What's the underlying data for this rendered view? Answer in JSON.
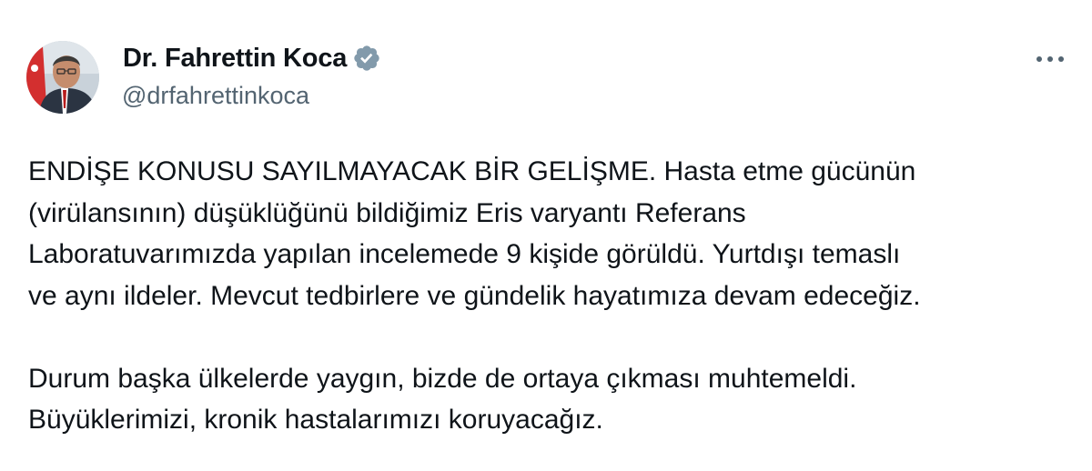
{
  "author": {
    "display_name": "Dr. Fahrettin Koca",
    "handle": "@drfahrettinkoca",
    "verified_icon": "verified-badge-icon",
    "avatar_icon": "profile-avatar",
    "more_icon": "more-options-icon"
  },
  "tweet": {
    "paragraphs": [
      {
        "lines": [
          "ENDİŞE KONUSU SAYILMAYACAK BİR GELİŞME. Hasta etme gücünün",
          "(virülansının) düşüklüğünü bildiğimiz Eris varyantı Referans",
          "Laboratuvarımızda yapılan incelemede 9 kişide görüldü. Yurtdışı temaslı",
          "ve aynı ildeler. Mevcut tedbirlere ve gündelik hayatımıza devam edeceğiz."
        ]
      },
      {
        "lines": [
          "Durum başka ülkelerde yaygın, bizde de ortaya çıkması muhtemeldi.",
          "Büyüklerimizi, kronik hastalarımızı koruyacağız."
        ]
      }
    ]
  },
  "colors": {
    "text": "#0f1419",
    "secondary_text": "#536471",
    "verified_badge": "#829aab",
    "background": "#ffffff"
  }
}
